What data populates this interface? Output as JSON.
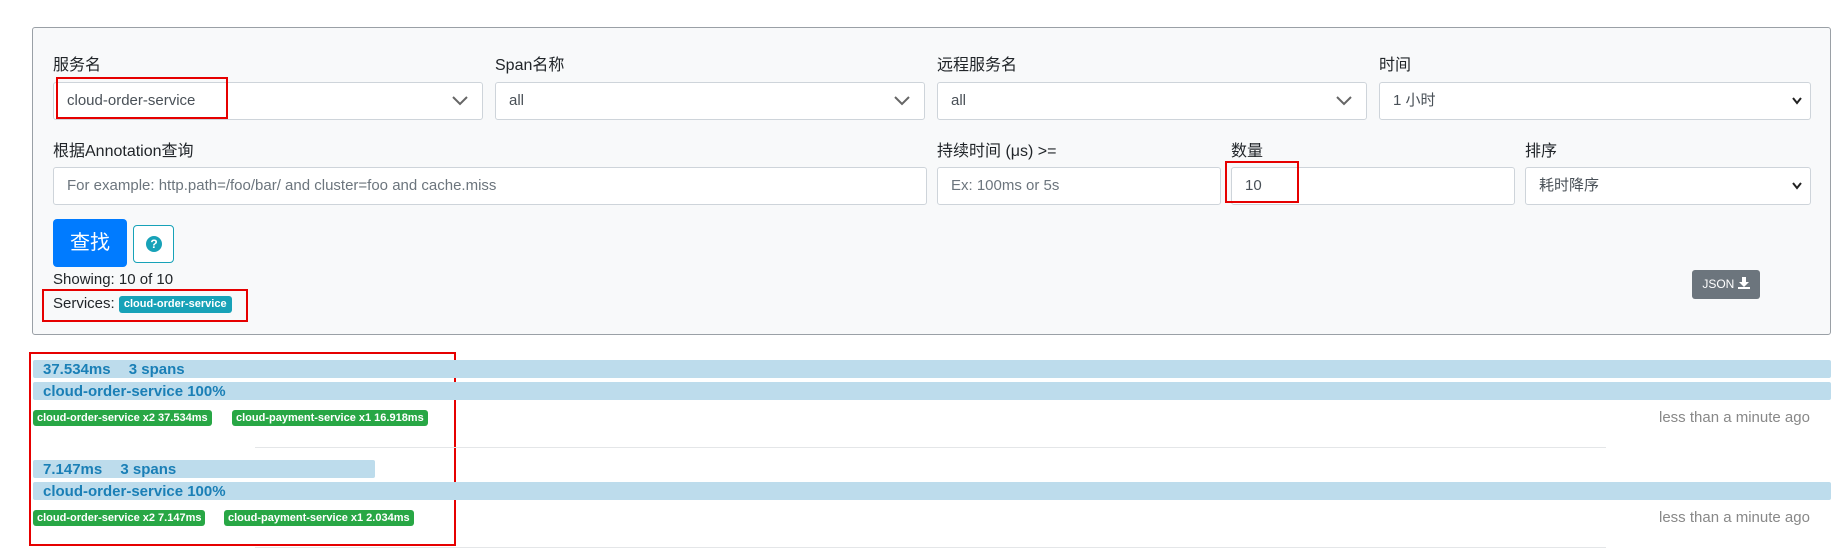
{
  "form": {
    "service_label": "服务名",
    "service_value": "cloud-order-service",
    "span_label": "Span名称",
    "span_value": "all",
    "remote_label": "远程服务名",
    "remote_value": "all",
    "time_label": "时间",
    "time_value": "1 小时",
    "annotation_label": "根据Annotation查询",
    "annotation_placeholder": "For example: http.path=/foo/bar/ and cluster=foo and cache.miss",
    "duration_label": "持续时间 (μs) >=",
    "duration_placeholder": "Ex: 100ms or 5s",
    "count_label": "数量",
    "count_value": "10",
    "sort_label": "排序",
    "sort_value": "耗时降序",
    "find_button": "查找",
    "help_icon": "question-circle-icon"
  },
  "results": {
    "showing_text": "Showing: 10 of 10",
    "services_label": "Services:",
    "services_badge": "cloud-order-service",
    "json_button": "JSON",
    "download_icon": "download-icon"
  },
  "traces": [
    {
      "duration": "37.534ms",
      "spans": "3 spans",
      "service_line": "cloud-order-service 100%",
      "badges": [
        "cloud-order-service x2 37.534ms",
        "cloud-payment-service x1 16.918ms"
      ],
      "time_ago": "less than a minute ago",
      "duration_fraction": 1.0
    },
    {
      "duration": "7.147ms",
      "spans": "3 spans",
      "service_line": "cloud-order-service 100%",
      "badges": [
        "cloud-order-service x2 7.147ms",
        "cloud-payment-service x1 2.034ms"
      ],
      "time_ago": "less than a minute ago",
      "duration_fraction": 0.19
    }
  ],
  "colors": {
    "primary": "#007bff",
    "info": "#17a2b8",
    "success": "#28a745",
    "highlight": "#e60000",
    "bar": "#bddcec"
  }
}
